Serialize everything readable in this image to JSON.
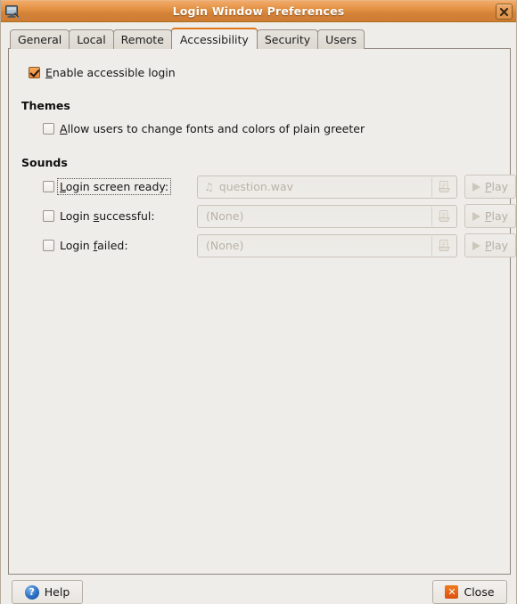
{
  "window": {
    "title": "Login Window Preferences",
    "icon": "login-window-icon",
    "close_button_icon": "window-close-icon",
    "titlebar_color": "#e08e3e",
    "background_color": "#efedea"
  },
  "tabs": [
    {
      "label": "General",
      "active": false
    },
    {
      "label": "Local",
      "active": false
    },
    {
      "label": "Remote",
      "active": false
    },
    {
      "label": "Accessibility",
      "active": true
    },
    {
      "label": "Security",
      "active": false
    },
    {
      "label": "Users",
      "active": false
    }
  ],
  "accessibility": {
    "enable_accessible_login": {
      "label_prefix": "",
      "mnemonic": "E",
      "label_rest": "nable accessible login",
      "checked": true
    },
    "themes": {
      "heading": "Themes",
      "allow_users": {
        "mnemonic": "A",
        "label_rest": "llow users to change fonts and colors of plain greeter",
        "checked": false
      }
    },
    "sounds": {
      "heading": "Sounds",
      "rows": [
        {
          "label_prefix": "",
          "mnemonic": "L",
          "label_rest": "ogin screen ready:",
          "checked": false,
          "focused": true,
          "file_value": "question.wav",
          "has_note_icon": true,
          "browse_icon": "file-open-icon",
          "play_label_prefix": "",
          "play_mnemonic": "P",
          "play_label_rest": "lay",
          "play_icon": "play-triangle-icon",
          "enabled": false
        },
        {
          "label_prefix": "Login ",
          "mnemonic": "s",
          "label_rest": "uccessful:",
          "checked": false,
          "focused": false,
          "file_value": "(None)",
          "has_note_icon": false,
          "browse_icon": "file-open-icon",
          "play_label_prefix": "",
          "play_mnemonic": "P",
          "play_label_rest": "lay",
          "play_icon": "play-triangle-icon",
          "enabled": false
        },
        {
          "label_prefix": "Login ",
          "mnemonic": "f",
          "label_rest": "ailed:",
          "checked": false,
          "focused": false,
          "file_value": "(None)",
          "has_note_icon": false,
          "browse_icon": "file-open-icon",
          "play_label_prefix": "",
          "play_mnemonic": "P",
          "play_label_rest": "lay",
          "play_icon": "play-triangle-icon",
          "enabled": false
        }
      ]
    }
  },
  "actions": {
    "help": {
      "label": "Help",
      "icon": "help-circle-icon",
      "icon_glyph": "?"
    },
    "close": {
      "label": "Close",
      "icon": "close-x-icon",
      "icon_glyph": "✕"
    }
  }
}
